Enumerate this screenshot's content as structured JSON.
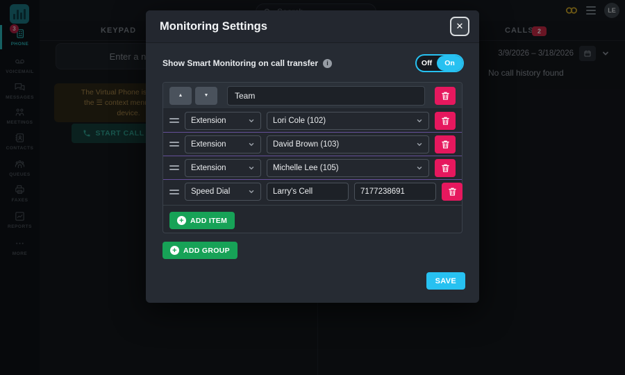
{
  "colors": {
    "accent_cyan": "#27c1f1",
    "accent_pink": "#e6185e",
    "accent_green": "#17a257",
    "accent_teal": "#2ab5b9",
    "badge_red": "#c62845",
    "separator_purple": "#66509a",
    "gold_icon": "#c9a227"
  },
  "sidebar": {
    "items": [
      {
        "label": "PHONE",
        "badge": "3"
      },
      {
        "label": "VOICEMAIL"
      },
      {
        "label": "MESSAGES"
      },
      {
        "label": "MEETINGS"
      },
      {
        "label": "CONTACTS"
      },
      {
        "label": "QUEUES"
      },
      {
        "label": "FAXES"
      },
      {
        "label": "REPORTS"
      },
      {
        "label": "MORE"
      }
    ]
  },
  "topbar": {
    "search_placeholder": "Search",
    "avatar_initials": "LE"
  },
  "background": {
    "keypad_tab": "KEYPAD",
    "dial_placeholder": "Enter a name or number",
    "warning": {
      "line1": "The Virtual Phone is disabled",
      "line2": "the ☰ context menu to start",
      "line3": "device."
    },
    "start_call_label": "START CALL ON MY E",
    "calls_tab": "CALLS",
    "calls_badge": "2",
    "date_range": "3/9/2026 – 3/18/2026",
    "no_history": "No call history found"
  },
  "modal": {
    "title": "Monitoring Settings",
    "close_glyph": "✕",
    "toggle_label": "Show Smart Monitoring on call transfer",
    "toggle_off": "Off",
    "toggle_on": "On",
    "toggle_state": "on",
    "group": {
      "name": "Team",
      "rows": [
        {
          "type": "Extension",
          "value": "Lori Cole (102)"
        },
        {
          "type": "Extension",
          "value": "David Brown (103)"
        },
        {
          "type": "Extension",
          "value": "Michelle Lee (105)"
        },
        {
          "type": "Speed Dial",
          "name": "Larry's Cell",
          "number": "7177238691"
        }
      ]
    },
    "add_item_label": "ADD ITEM",
    "add_group_label": "ADD GROUP",
    "save_label": "SAVE"
  }
}
